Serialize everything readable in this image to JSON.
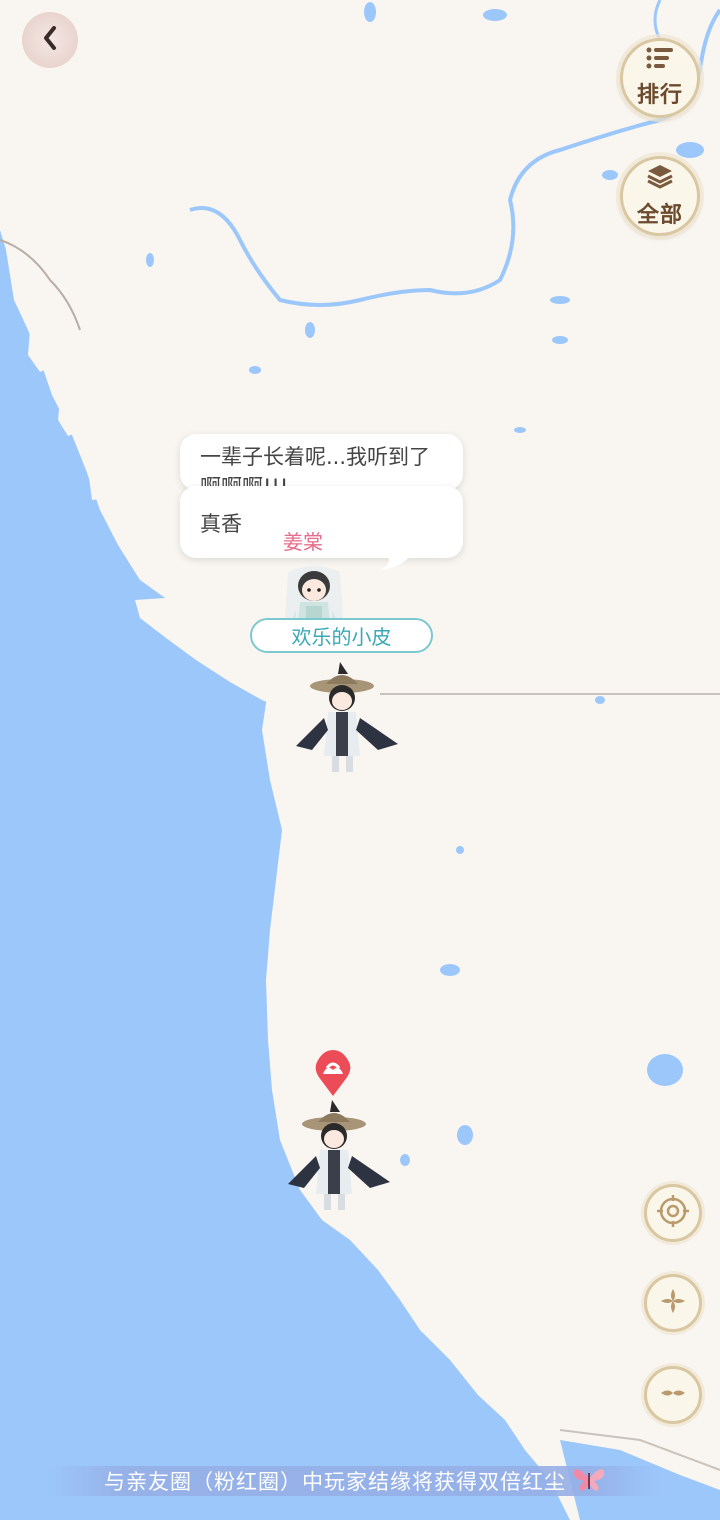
{
  "header": {
    "back_icon": "chevron-left-icon"
  },
  "top_right": {
    "rank_label": "排行",
    "rank_icon": "list-icon",
    "all_label": "全部",
    "all_icon": "layers-icon"
  },
  "chat": {
    "bubble_back_text": "一辈子长着呢...我听到了啊啊啊!!!",
    "bubble_front_text": "真香",
    "speaker_name": "姜棠"
  },
  "player": {
    "name": "欢乐的小皮"
  },
  "controls": {
    "locate_icon": "target-icon",
    "zoom_in_icon": "plus-icon",
    "zoom_out_icon": "minus-icon"
  },
  "banner": {
    "text": "与亲友圈（粉红圈）中玩家结缘将获得双倍红尘"
  },
  "colors": {
    "water": "#9cc7fb",
    "land": "#f9f6f1",
    "accent": "#ec4c58",
    "tag": "#3aa9b6",
    "pink": "#e76b8a"
  }
}
